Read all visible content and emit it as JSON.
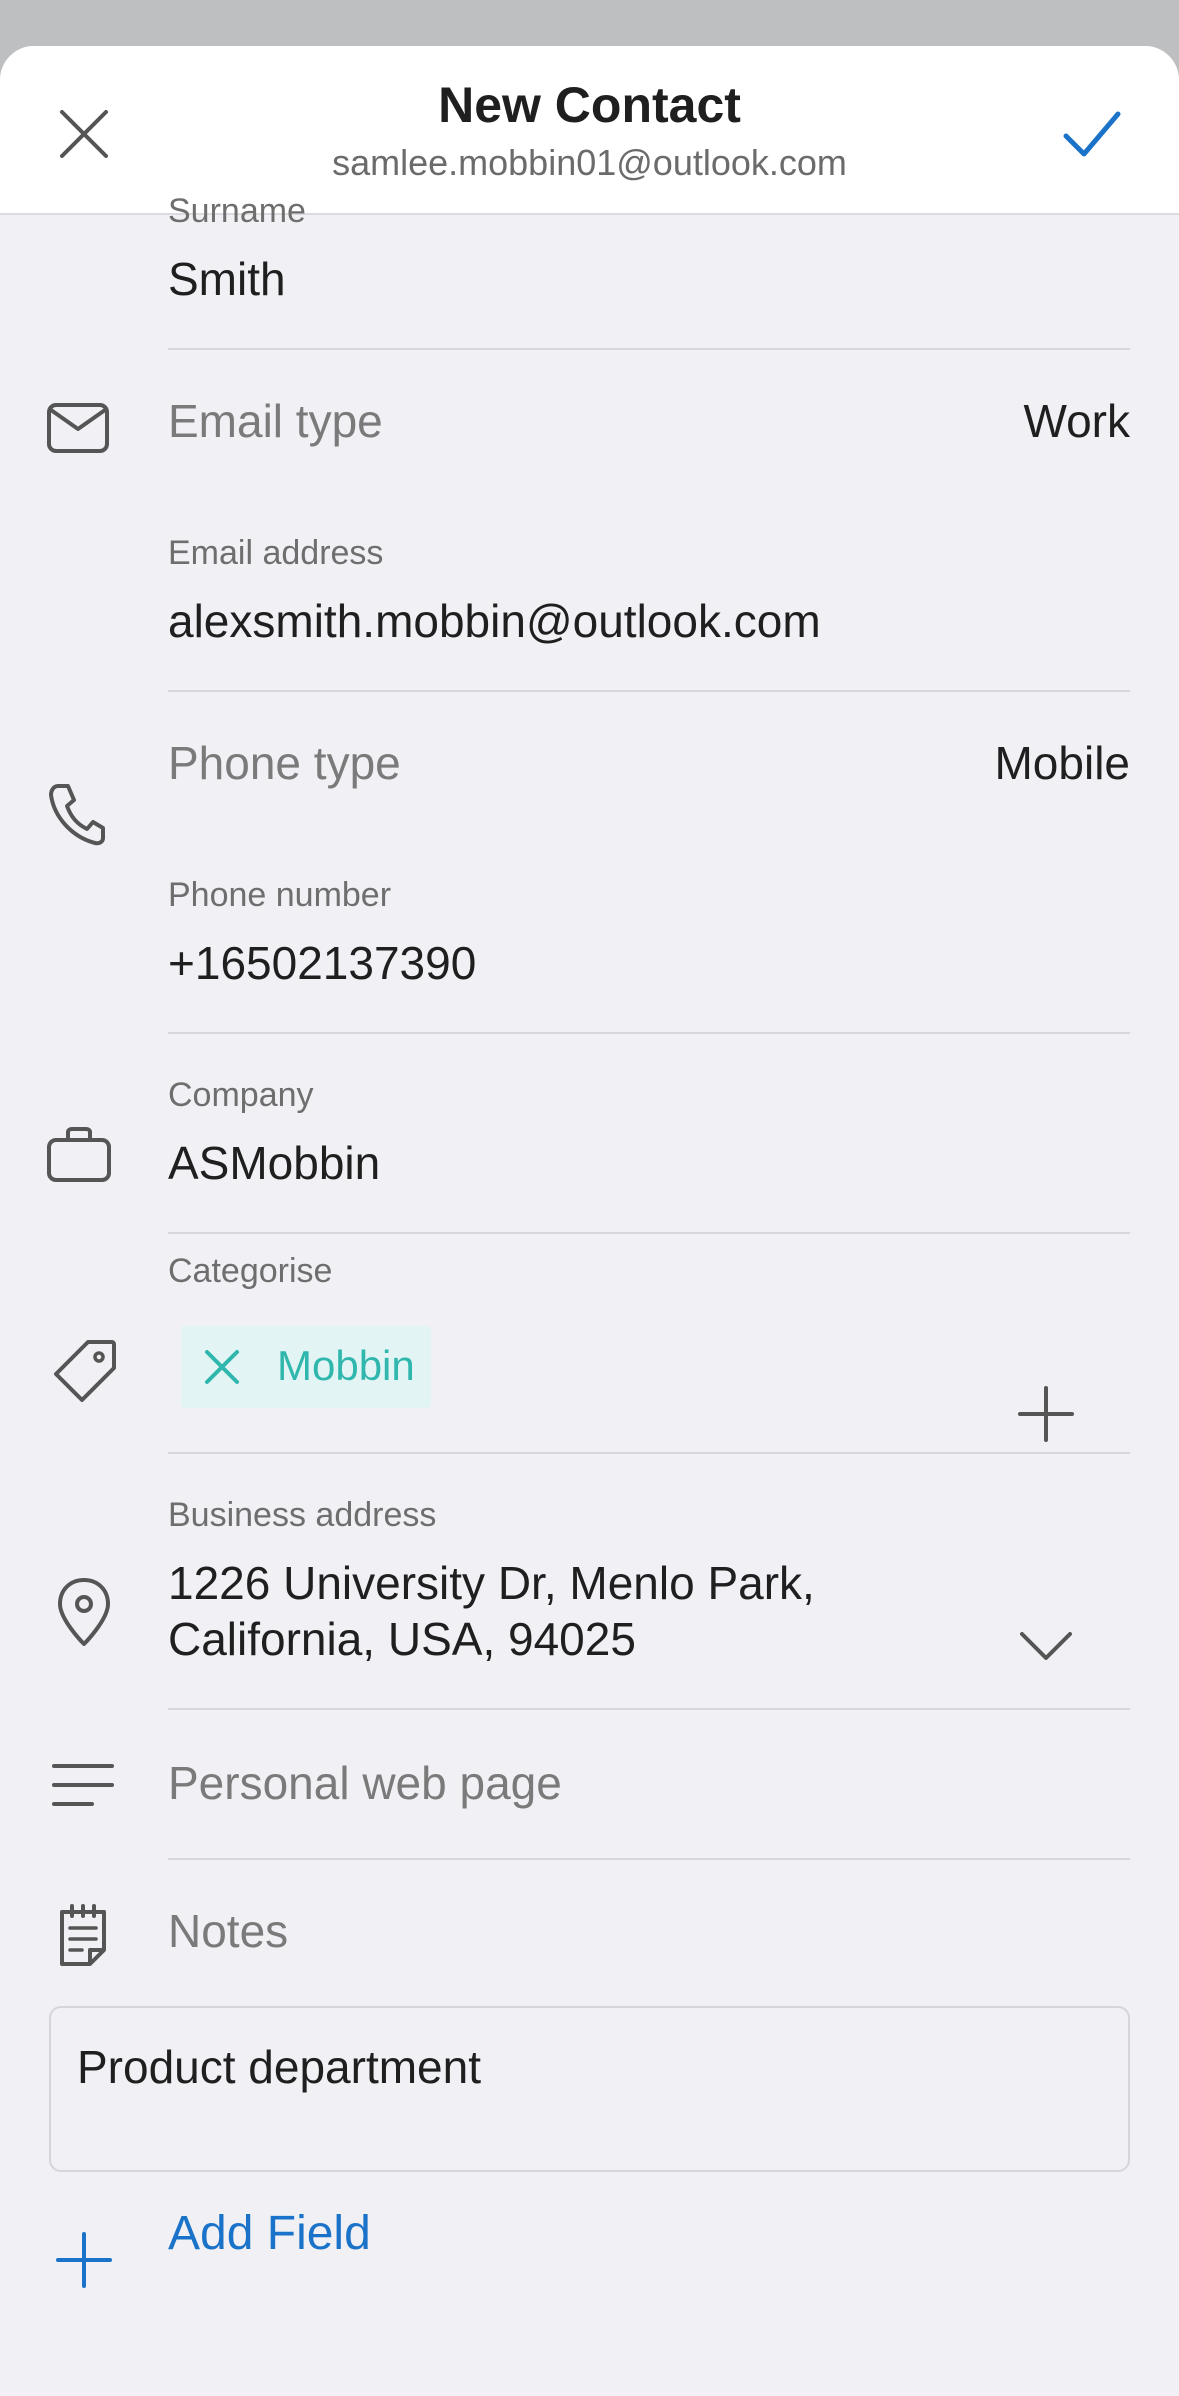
{
  "header": {
    "title": "New Contact",
    "account": "samlee.mobbin01@outlook.com"
  },
  "fields": {
    "surname": {
      "label": "Surname",
      "value": "Smith"
    },
    "email_type": {
      "placeholder": "Email type",
      "value": "Work"
    },
    "email_address": {
      "label": "Email address",
      "value": "alexsmith.mobbin@outlook.com"
    },
    "phone_type": {
      "placeholder": "Phone type",
      "value": "Mobile"
    },
    "phone_number": {
      "label": "Phone number",
      "value": "+16502137390"
    },
    "company": {
      "label": "Company",
      "value": "ASMobbin"
    },
    "categorise": {
      "label": "Categorise",
      "chip": "Mobbin"
    },
    "business_address": {
      "label": "Business address",
      "line1": "1226 University Dr, Menlo Park,",
      "line2": "California, USA, 94025"
    },
    "web_page": {
      "placeholder": "Personal web page"
    },
    "notes": {
      "placeholder": "Notes",
      "value": "Product department"
    }
  },
  "add_field": {
    "label": "Add Field"
  },
  "colors": {
    "accent": "#1a73c8",
    "chip_text": "#2fb7ad",
    "chip_bg": "#e2f4f4",
    "background": "#f0f0f5"
  },
  "icons": {
    "close": "close-icon",
    "done": "checkmark-icon",
    "email": "envelope-icon",
    "phone": "phone-icon",
    "company": "briefcase-icon",
    "category": "tag-icon",
    "chip_remove": "close-icon",
    "add_category": "plus-icon",
    "address": "location-pin-icon",
    "expand": "chevron-down-icon",
    "web": "lines-icon",
    "notes": "notepad-icon",
    "add_field": "plus-icon"
  }
}
